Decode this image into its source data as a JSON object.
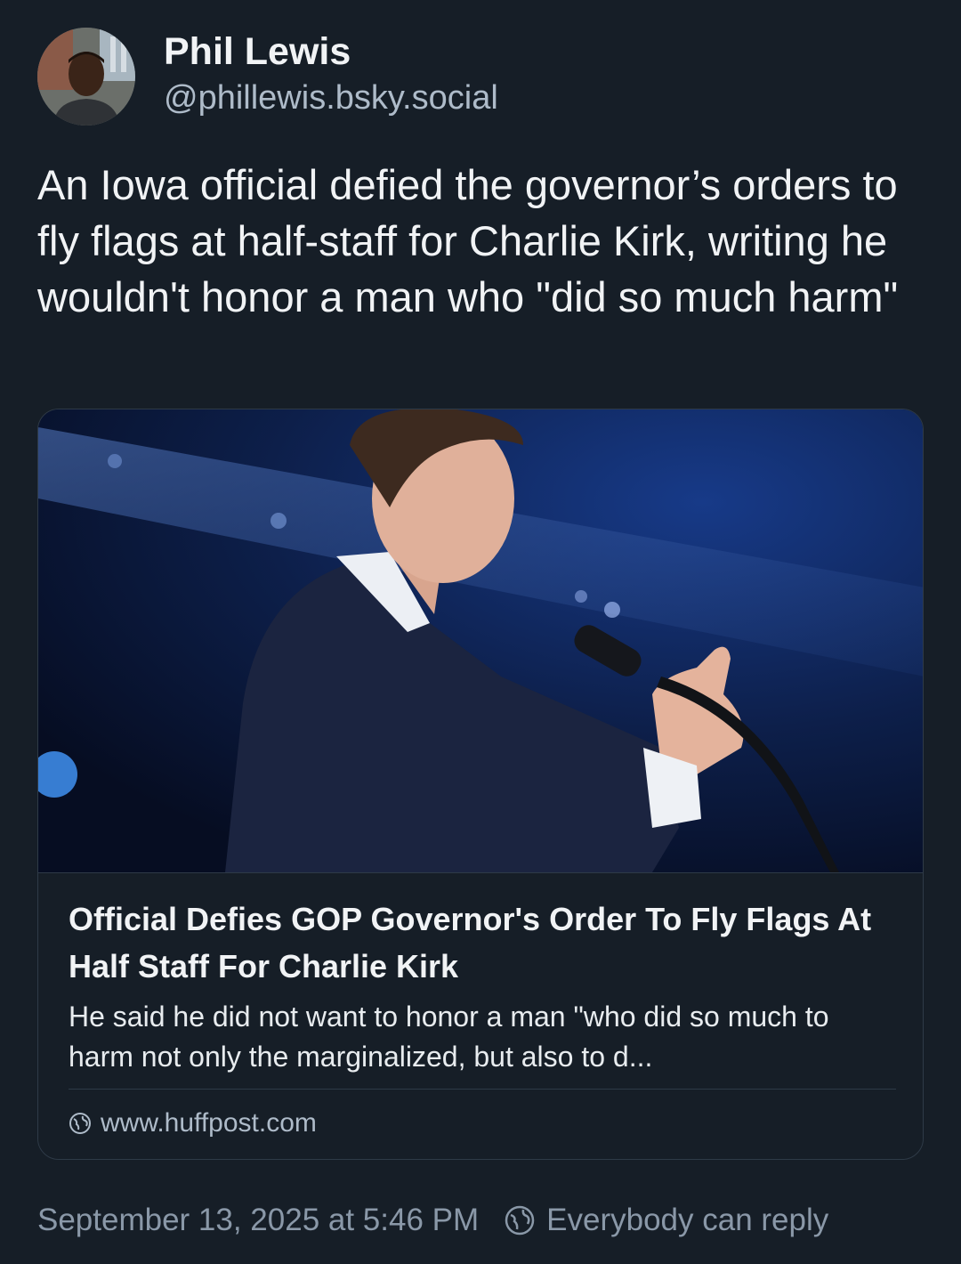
{
  "author": {
    "display_name": "Phil Lewis",
    "handle": "@phillewis.bsky.social",
    "avatar_icon": "user-avatar"
  },
  "post": {
    "text": "An Iowa official defied the governor’s orders to fly flags at half-staff for Charlie Kirk, writing he wouldn't honor a man who \"did so much harm\""
  },
  "embed": {
    "image_icon": "speaker-at-microphone-photo",
    "title": "Official Defies GOP Governor's Order To Fly Flags At Half Staff For Charlie Kirk",
    "description": "He said he did not want to honor a man \"who did so much to harm not only the marginalized, but also to d...",
    "domain": "www.huffpost.com",
    "domain_icon": "globe-icon"
  },
  "footer": {
    "timestamp": "September 13, 2025 at 5:46 PM",
    "reply_setting": "Everybody can reply",
    "reply_icon": "globe-icon"
  },
  "colors": {
    "background": "#161e27",
    "text_primary": "#f1f3f5",
    "text_secondary": "#aebbc9",
    "text_muted": "#8a98a8",
    "border": "#2e3a47"
  }
}
